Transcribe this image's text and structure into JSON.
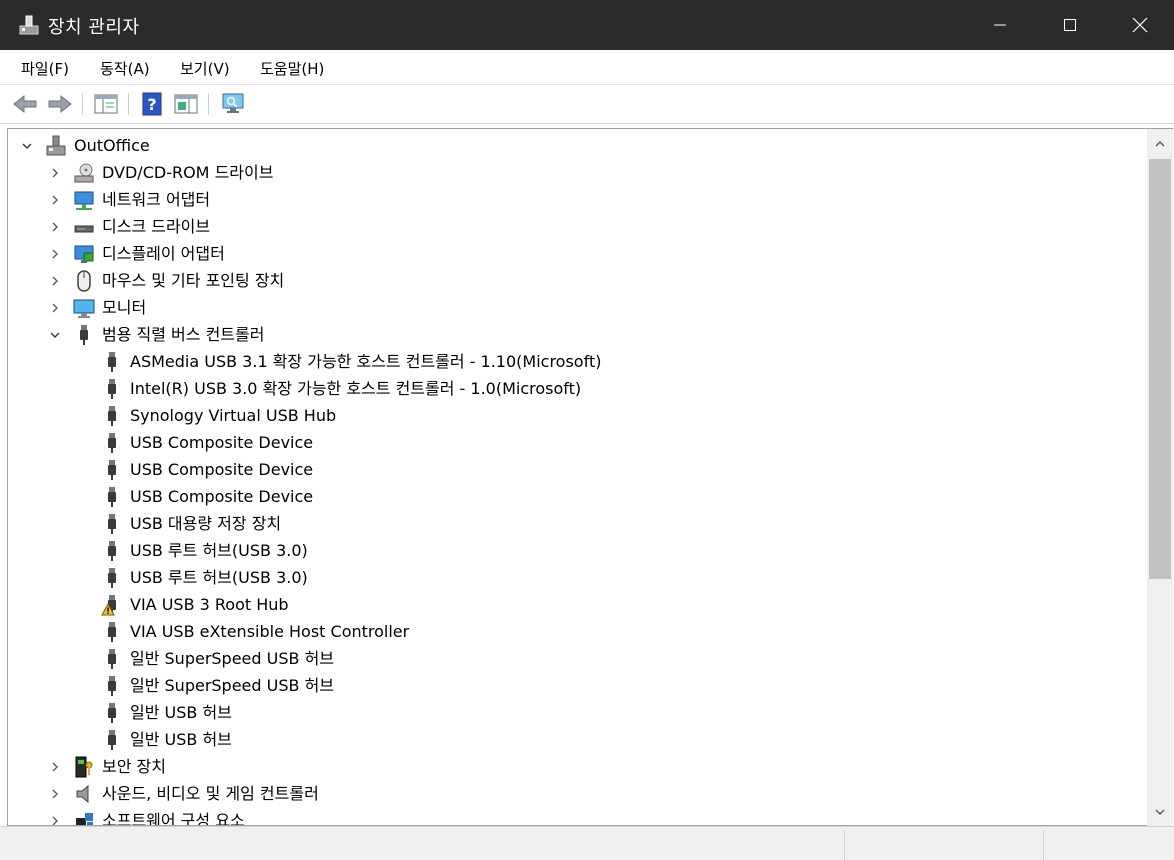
{
  "window": {
    "title": "장치 관리자"
  },
  "menu": [
    "파일(F)",
    "동작(A)",
    "보기(V)",
    "도움말(H)"
  ],
  "toolbar": [
    "back-icon",
    "forward-icon",
    "properties-pane-icon",
    "help-icon",
    "show-hidden-icon",
    "monitor-scan-icon"
  ],
  "colors": {
    "titlebar": "#2b2b2b",
    "selection": "#cce8ff",
    "usb_icon": "#3a3a3a",
    "warning": "#f2c12e"
  },
  "tree": {
    "root": "OutOffice",
    "items": [
      {
        "label": "DVD/CD-ROM 드라이브",
        "icon": "dvd-drive-icon",
        "expanded": false
      },
      {
        "label": "네트워크 어댑터",
        "icon": "network-adapter-icon",
        "expanded": false
      },
      {
        "label": "디스크 드라이브",
        "icon": "disk-drive-icon",
        "expanded": false
      },
      {
        "label": "디스플레이 어댑터",
        "icon": "display-adapter-icon",
        "expanded": false
      },
      {
        "label": "마우스 및 기타 포인팅 장치",
        "icon": "mouse-icon",
        "expanded": false
      },
      {
        "label": "모니터",
        "icon": "monitor-icon",
        "expanded": false
      },
      {
        "label": "범용 직렬 버스 컨트롤러",
        "icon": "usb-icon",
        "expanded": true,
        "children": [
          {
            "label": "ASMedia USB 3.1 확장 가능한 호스트 컨트롤러 - 1.10(Microsoft)",
            "icon": "usb-icon"
          },
          {
            "label": "Intel(R) USB 3.0 확장 가능한 호스트 컨트롤러 - 1.0(Microsoft)",
            "icon": "usb-icon"
          },
          {
            "label": "Synology Virtual USB Hub",
            "icon": "usb-icon"
          },
          {
            "label": "USB Composite Device",
            "icon": "usb-icon"
          },
          {
            "label": "USB Composite Device",
            "icon": "usb-icon"
          },
          {
            "label": "USB Composite Device",
            "icon": "usb-icon"
          },
          {
            "label": "USB 대용량 저장 장치",
            "icon": "usb-icon"
          },
          {
            "label": "USB 루트 허브(USB 3.0)",
            "icon": "usb-icon"
          },
          {
            "label": "USB 루트 허브(USB 3.0)",
            "icon": "usb-icon"
          },
          {
            "label": "VIA USB 3 Root Hub",
            "icon": "usb-warning-icon"
          },
          {
            "label": "VIA USB eXtensible Host Controller",
            "icon": "usb-icon"
          },
          {
            "label": "일반 SuperSpeed USB 허브",
            "icon": "usb-icon"
          },
          {
            "label": "일반 SuperSpeed USB 허브",
            "icon": "usb-icon"
          },
          {
            "label": "일반 USB 허브",
            "icon": "usb-icon"
          },
          {
            "label": "일반 USB 허브",
            "icon": "usb-icon"
          }
        ]
      },
      {
        "label": "보안 장치",
        "icon": "security-device-icon",
        "expanded": false
      },
      {
        "label": "사운드, 비디오 및 게임 컨트롤러",
        "icon": "speaker-icon",
        "expanded": false
      },
      {
        "label": "소프트웨어 구성 요소",
        "icon": "software-component-icon",
        "expanded": false
      }
    ]
  }
}
